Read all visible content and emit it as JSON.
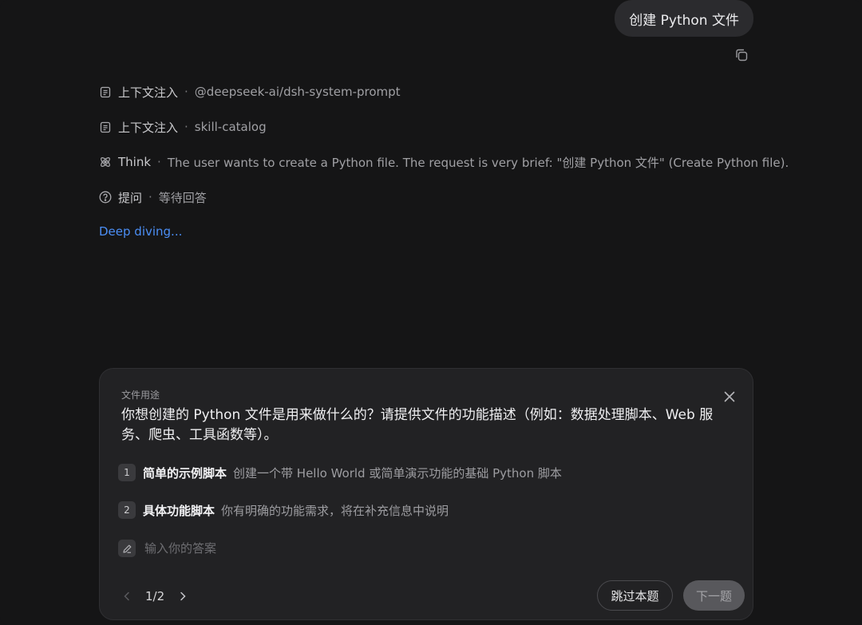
{
  "user_message": "创建 Python 文件",
  "steps": [
    {
      "label": "上下文注入",
      "detail": "@deepseek-ai/dsh-system-prompt",
      "icon": "document-icon"
    },
    {
      "label": "上下文注入",
      "detail": "skill-catalog",
      "icon": "document-icon"
    },
    {
      "label": "Think",
      "detail": "The user wants to create a Python file. The request is very brief: \"创建 Python 文件\" (Create Python file).",
      "icon": "atom-icon"
    },
    {
      "label": "提问",
      "detail": "等待回答",
      "icon": "question-circle-icon"
    }
  ],
  "separator": "·",
  "status": "Deep diving...",
  "question_panel": {
    "category": "文件用途",
    "question": "你想创建的 Python 文件是用来做什么的？请提供文件的功能描述（例如：数据处理脚本、Web 服务、爬虫、工具函数等）。",
    "options": [
      {
        "number": "1",
        "title": "简单的示例脚本",
        "desc": "创建一个带 Hello World 或简单演示功能的基础 Python 脚本"
      },
      {
        "number": "2",
        "title": "具体功能脚本",
        "desc": "你有明确的功能需求，将在补充信息中说明"
      }
    ],
    "answer_placeholder": "输入你的答案",
    "page": "1/2",
    "skip_label": "跳过本题",
    "next_label": "下一题"
  },
  "colors": {
    "background": "#151516",
    "panel": "#222224",
    "accent": "#4b8ef5"
  }
}
